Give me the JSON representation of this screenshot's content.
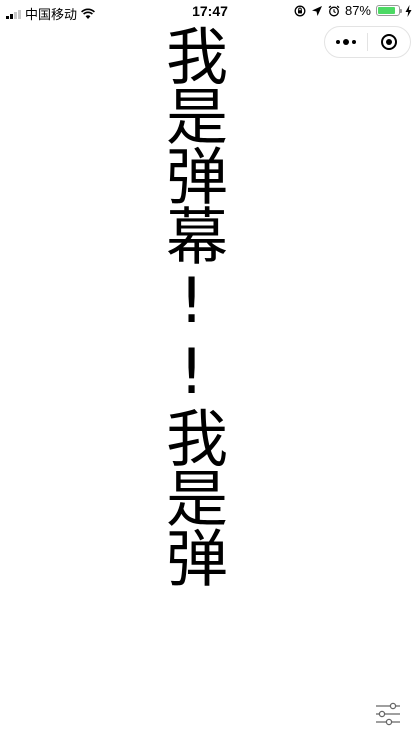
{
  "status_bar": {
    "carrier": "中国移动",
    "time": "17:47",
    "battery": "87%",
    "battery_level": 0.87
  },
  "danmu": {
    "text": "我是弹幕!!我是弹"
  },
  "icons": {
    "wifi": "wifi-icon",
    "lock": "orientation-lock-icon",
    "location": "location-arrow-icon",
    "alarm": "alarm-icon",
    "charging": "charging-icon",
    "more": "more-dots-icon",
    "close": "target-icon",
    "settings": "sliders-icon"
  }
}
